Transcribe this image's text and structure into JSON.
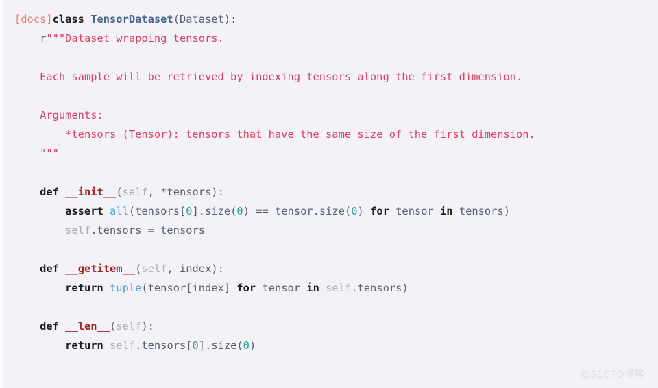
{
  "window": {
    "background_color": "#f2f2f7",
    "gutter_color": "#fbfbfd"
  },
  "watermark": {
    "text": "@51CTO博客",
    "color": "#dcdce2"
  },
  "palette": {
    "docs_link": "#ee7f70",
    "keyword": "#1c1c1c",
    "class_name": "#44668f",
    "function_name": "#a32222",
    "plain_text": "#58616e",
    "docstring": "#dd3f66",
    "self_param": "#a8adb5",
    "builtin": "#4fa3d9",
    "number": "#2aa198",
    "operator": "#1c1c1c"
  },
  "code": {
    "language": "python",
    "source_plain": "[docs]class TensorDataset(Dataset):\n    r\"\"\"Dataset wrapping tensors.\n\n    Each sample will be retrieved by indexing tensors along the first dimension.\n\n    Arguments:\n        *tensors (Tensor): tensors that have the same size of the first dimension.\n    \"\"\"\n\n    def __init__(self, *tensors):\n        assert all(tensors[0].size(0) == tensor.size(0) for tensor in tensors)\n        self.tensors = tensors\n\n    def __getitem__(self, index):\n        return tuple(tensor[index] for tensor in self.tensors)\n\n    def __len__(self):\n        return self.tensors[0].size(0)",
    "lines": [
      {
        "n": 1,
        "tokens": [
          {
            "t": "[docs]",
            "c": "docs"
          },
          {
            "t": "class",
            "c": "kw"
          },
          {
            "t": " ",
            "c": "plain"
          },
          {
            "t": "TensorDataset",
            "c": "classname"
          },
          {
            "t": "(Dataset):",
            "c": "plain"
          }
        ]
      },
      {
        "n": 2,
        "tokens": [
          {
            "t": "    ",
            "c": "plain"
          },
          {
            "t": "r",
            "c": "plain"
          },
          {
            "t": "\"\"\"Dataset wrapping tensors.",
            "c": "string"
          }
        ]
      },
      {
        "n": 3,
        "tokens": []
      },
      {
        "n": 4,
        "tokens": [
          {
            "t": "    ",
            "c": "plain"
          },
          {
            "t": "Each sample will be retrieved by indexing tensors along the first dimension.",
            "c": "string"
          }
        ]
      },
      {
        "n": 5,
        "tokens": []
      },
      {
        "n": 6,
        "tokens": [
          {
            "t": "    ",
            "c": "plain"
          },
          {
            "t": "Arguments:",
            "c": "string"
          }
        ]
      },
      {
        "n": 7,
        "tokens": [
          {
            "t": "        ",
            "c": "plain"
          },
          {
            "t": "*tensors (Tensor): tensors that have the same size of the first dimension.",
            "c": "string"
          }
        ]
      },
      {
        "n": 8,
        "tokens": [
          {
            "t": "    ",
            "c": "plain"
          },
          {
            "t": "\"\"\"",
            "c": "string"
          }
        ]
      },
      {
        "n": 9,
        "tokens": []
      },
      {
        "n": 10,
        "tokens": [
          {
            "t": "    ",
            "c": "plain"
          },
          {
            "t": "def",
            "c": "kw"
          },
          {
            "t": " ",
            "c": "plain"
          },
          {
            "t": "__init__",
            "c": "funcname"
          },
          {
            "t": "(",
            "c": "punc"
          },
          {
            "t": "self",
            "c": "self"
          },
          {
            "t": ", *tensors):",
            "c": "plain"
          }
        ]
      },
      {
        "n": 11,
        "tokens": [
          {
            "t": "        ",
            "c": "plain"
          },
          {
            "t": "assert",
            "c": "kw"
          },
          {
            "t": " ",
            "c": "plain"
          },
          {
            "t": "all",
            "c": "builtin"
          },
          {
            "t": "(tensors[",
            "c": "plain"
          },
          {
            "t": "0",
            "c": "num"
          },
          {
            "t": "].size(",
            "c": "plain"
          },
          {
            "t": "0",
            "c": "num"
          },
          {
            "t": ") ",
            "c": "plain"
          },
          {
            "t": "==",
            "c": "op"
          },
          {
            "t": " tensor.size(",
            "c": "plain"
          },
          {
            "t": "0",
            "c": "num"
          },
          {
            "t": ") ",
            "c": "plain"
          },
          {
            "t": "for",
            "c": "kw"
          },
          {
            "t": " tensor ",
            "c": "plain"
          },
          {
            "t": "in",
            "c": "kw"
          },
          {
            "t": " tensors)",
            "c": "plain"
          }
        ]
      },
      {
        "n": 12,
        "tokens": [
          {
            "t": "        ",
            "c": "plain"
          },
          {
            "t": "self",
            "c": "self"
          },
          {
            "t": ".tensors = tensors",
            "c": "plain"
          }
        ]
      },
      {
        "n": 13,
        "tokens": []
      },
      {
        "n": 14,
        "tokens": [
          {
            "t": "    ",
            "c": "plain"
          },
          {
            "t": "def",
            "c": "kw"
          },
          {
            "t": " ",
            "c": "plain"
          },
          {
            "t": "__getitem__",
            "c": "funcname"
          },
          {
            "t": "(",
            "c": "punc"
          },
          {
            "t": "self",
            "c": "self"
          },
          {
            "t": ", index):",
            "c": "plain"
          }
        ]
      },
      {
        "n": 15,
        "tokens": [
          {
            "t": "        ",
            "c": "plain"
          },
          {
            "t": "return",
            "c": "kw"
          },
          {
            "t": " ",
            "c": "plain"
          },
          {
            "t": "tuple",
            "c": "builtin"
          },
          {
            "t": "(tensor[index] ",
            "c": "plain"
          },
          {
            "t": "for",
            "c": "kw"
          },
          {
            "t": " tensor ",
            "c": "plain"
          },
          {
            "t": "in",
            "c": "kw"
          },
          {
            "t": " ",
            "c": "plain"
          },
          {
            "t": "self",
            "c": "self"
          },
          {
            "t": ".tensors)",
            "c": "plain"
          }
        ]
      },
      {
        "n": 16,
        "tokens": []
      },
      {
        "n": 17,
        "tokens": [
          {
            "t": "    ",
            "c": "plain"
          },
          {
            "t": "def",
            "c": "kw"
          },
          {
            "t": " ",
            "c": "plain"
          },
          {
            "t": "__len__",
            "c": "funcname"
          },
          {
            "t": "(",
            "c": "punc"
          },
          {
            "t": "self",
            "c": "self"
          },
          {
            "t": "):",
            "c": "plain"
          }
        ]
      },
      {
        "n": 18,
        "tokens": [
          {
            "t": "        ",
            "c": "plain"
          },
          {
            "t": "return",
            "c": "kw"
          },
          {
            "t": " ",
            "c": "plain"
          },
          {
            "t": "self",
            "c": "self"
          },
          {
            "t": ".tensors[",
            "c": "plain"
          },
          {
            "t": "0",
            "c": "num"
          },
          {
            "t": "].size(",
            "c": "plain"
          },
          {
            "t": "0",
            "c": "num"
          },
          {
            "t": ")",
            "c": "plain"
          }
        ]
      }
    ]
  }
}
